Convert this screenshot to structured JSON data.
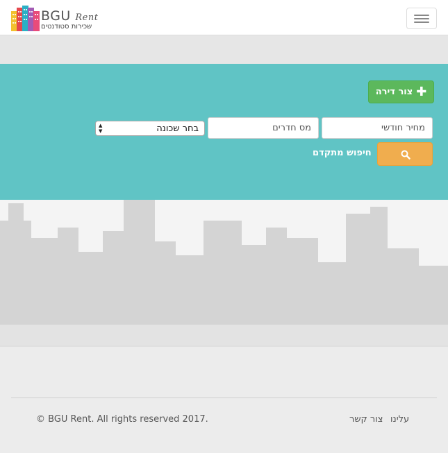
{
  "brand": {
    "title": "BGU",
    "title_suffix": "Rent",
    "subtitle": "שכירות סטודנטים",
    "bar_colors": [
      "#f2c12e",
      "#e5484d",
      "#2ab0c5",
      "#a35bb4",
      "#e94b7a"
    ]
  },
  "search": {
    "add_apartment_label": "צור דירה",
    "price_placeholder": "מחיר חודשי",
    "rooms_placeholder": "מס חדרים",
    "neighborhood_select": "בחר שכונה",
    "advanced_search_label": "חיפוש מתקדם",
    "colors": {
      "background": "#60c4c5",
      "add_button": "#5cb85c",
      "search_button": "#f0ad4e"
    }
  },
  "footer": {
    "copyright": "© BGU Rent. All rights reserved 2017.",
    "links": [
      "עלינו",
      "צור קשר"
    ]
  }
}
